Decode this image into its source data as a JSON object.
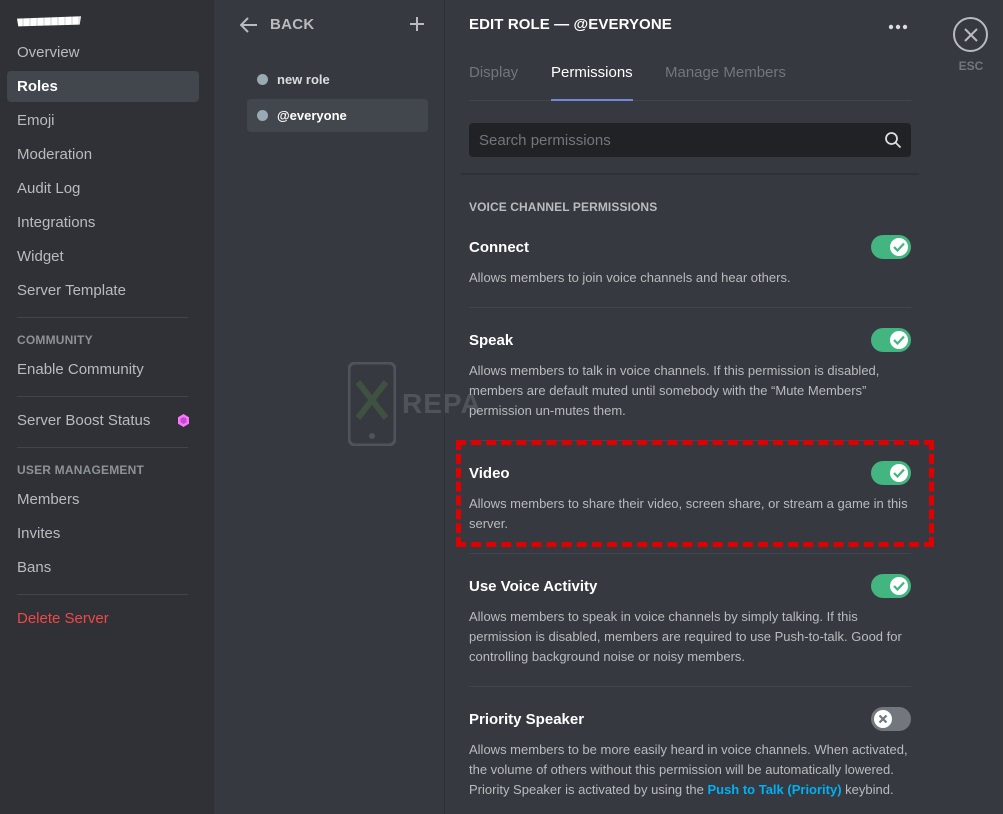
{
  "sidebar": {
    "items": {
      "overview": "Overview",
      "roles": "Roles",
      "emoji": "Emoji",
      "moderation": "Moderation",
      "audit_log": "Audit Log",
      "integrations": "Integrations",
      "widget": "Widget",
      "server_template": "Server Template",
      "enable_community": "Enable Community",
      "server_boost_status": "Server Boost Status",
      "members": "Members",
      "invites": "Invites",
      "bans": "Bans",
      "delete_server": "Delete Server"
    },
    "headers": {
      "community": "COMMUNITY",
      "user_management": "USER MANAGEMENT"
    },
    "active_item": "Roles"
  },
  "roles_panel": {
    "back_label": "BACK",
    "roles": [
      {
        "name": "new role",
        "active": false
      },
      {
        "name": "@everyone",
        "active": true
      }
    ]
  },
  "main": {
    "title": "EDIT ROLE — @EVERYONE",
    "tabs": [
      "Display",
      "Permissions",
      "Manage Members"
    ],
    "active_tab": "Permissions",
    "search_placeholder": "Search permissions",
    "section_header": "VOICE CHANNEL PERMISSIONS",
    "permissions": [
      {
        "name": "Connect",
        "desc": "Allows members to join voice channels and hear others.",
        "enabled": true
      },
      {
        "name": "Speak",
        "desc": "Allows members to talk in voice channels. If this permission is disabled, members are default muted until somebody with the “Mute Members” permission un-mutes them.",
        "enabled": true
      },
      {
        "name": "Video",
        "desc": "Allows members to share their video, screen share, or stream a game in this server.",
        "enabled": true
      },
      {
        "name": "Use Voice Activity",
        "desc": "Allows members to speak in voice channels by simply talking. If this permission is disabled, members are required to use Push-to-talk. Good for controlling background noise or noisy members.",
        "enabled": true
      },
      {
        "name": "Priority Speaker",
        "desc_before": "Allows members to be more easily heard in voice channels. When activated, the volume of others without this permission will be automatically lowered. Priority Speaker is activated by using the ",
        "desc_link": "Push to Talk (Priority)",
        "desc_after": " keybind.",
        "enabled": false
      }
    ]
  },
  "close": {
    "esc_label": "ESC"
  },
  "watermark": {
    "text": "REPA"
  },
  "colors": {
    "background": "#36393f",
    "sidebar": "#2f3136",
    "toggle_on": "#43b581",
    "toggle_off": "#72767d",
    "accent": "#7289da",
    "danger": "#f04747",
    "link": "#00b0f4",
    "highlight": "#e00000",
    "boost": "#ff73fa"
  }
}
